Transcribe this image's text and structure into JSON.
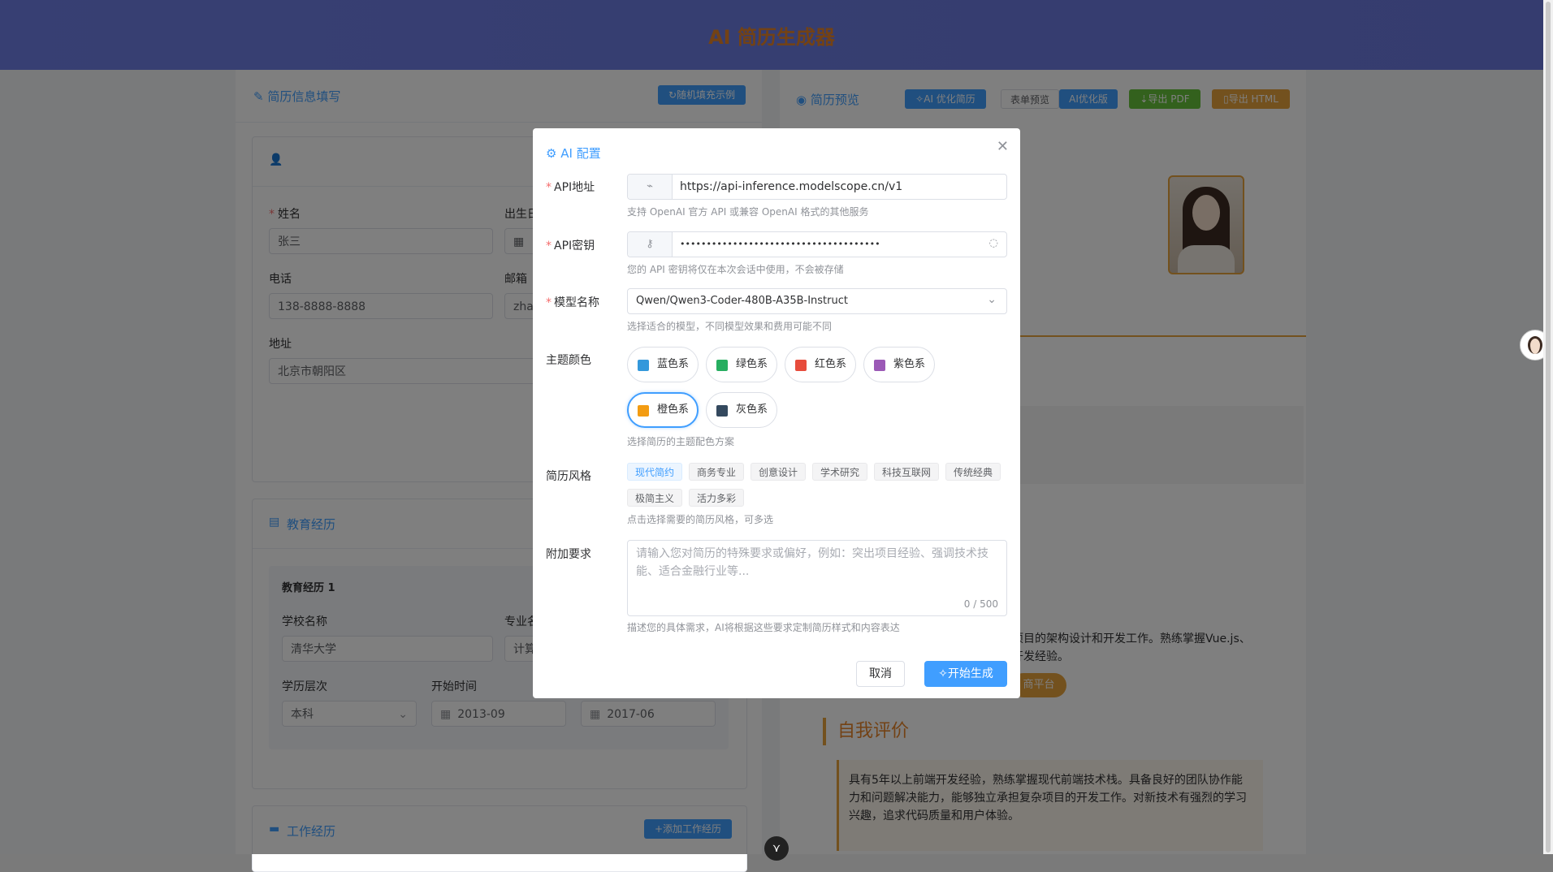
{
  "app": {
    "title": "AI 简历生成器"
  },
  "left": {
    "title": "简历信息填写",
    "random_fill": "随机填充示例",
    "fields": {
      "name_label": "姓名",
      "name_value": "张三",
      "birth_label": "出生日",
      "phone_label": "电话",
      "phone_value": "138-8888-8888",
      "email_label": "邮箱",
      "email_value": "zha",
      "address_label": "地址",
      "address_value": "北京市朝阳区"
    },
    "education": {
      "title": "教育经历",
      "item_title": "教育经历 1",
      "school_label": "学校名称",
      "school_value": "清华大学",
      "major_label": "专业名",
      "major_value": "计算",
      "level_label": "学历层次",
      "level_value": "本科",
      "start_label": "开始时间",
      "start_value": "2013-09",
      "end_value": "2017-06"
    },
    "work": {
      "title": "工作经历",
      "add_label": "添加工作经历"
    }
  },
  "right": {
    "title": "简历预览",
    "ai_optimize": "AI 优化简历",
    "tab_form": "表单预览",
    "tab_ai": "AI优化版",
    "export_pdf": "导出 PDF",
    "export_html": "导出 HTML",
    "exp_text_1": "心项目的架构设计和开发工作。熟练掌握Vue.js、",
    "exp_text_2": "目开发经验。",
    "tag_text": "商平台",
    "self_eval_title": "自我评价",
    "self_eval_text": "具有5年以上前端开发经验，熟练掌握现代前端技术栈。具备良好的团队协作能力和问题解决能力，能够独立承担复杂项目的开发工作。对新技术有强烈的学习兴趣，追求代码质量和用户体验。"
  },
  "dialog": {
    "title": "AI 配置",
    "api_url_label": "API地址",
    "api_url_value": "https://api-inference.modelscope.cn/v1",
    "api_url_hint": "支持 OpenAI 官方 API 或兼容 OpenAI 格式的其他服务",
    "api_key_label": "API密钥",
    "api_key_value": "••••••••••••••••••••••••••••••••••••••",
    "api_key_hint": "您的 API 密钥将仅在本次会话中使用，不会被存储",
    "model_label": "模型名称",
    "model_value": "Qwen/Qwen3-Coder-480B-A35B-Instruct",
    "model_hint": "选择适合的模型，不同模型效果和费用可能不同",
    "theme_label": "主题颜色",
    "themes": [
      {
        "label": "蓝色系",
        "color": "#3498db"
      },
      {
        "label": "绿色系",
        "color": "#27ae60"
      },
      {
        "label": "红色系",
        "color": "#e74c3c"
      },
      {
        "label": "紫色系",
        "color": "#9b59b6"
      },
      {
        "label": "橙色系",
        "color": "#f39c12"
      },
      {
        "label": "灰色系",
        "color": "#34495e"
      }
    ],
    "theme_selected": "橙色系",
    "theme_hint": "选择简历的主题配色方案",
    "style_label": "简历风格",
    "styles": [
      "现代简约",
      "商务专业",
      "创意设计",
      "学术研究",
      "科技互联网",
      "传统经典",
      "极简主义",
      "活力多彩"
    ],
    "style_selected": "现代简约",
    "style_hint": "点击选择需要的简历风格，可多选",
    "extra_label": "附加要求",
    "extra_placeholder": "请输入您对简历的特殊要求或偏好，例如：突出项目经验、强调技术技能、适合金融行业等...",
    "extra_counter": "0 / 500",
    "extra_hint": "描述您的具体需求，AI将根据这些要求定制简历样式和内容表达",
    "cancel": "取消",
    "generate": "开始生成"
  }
}
